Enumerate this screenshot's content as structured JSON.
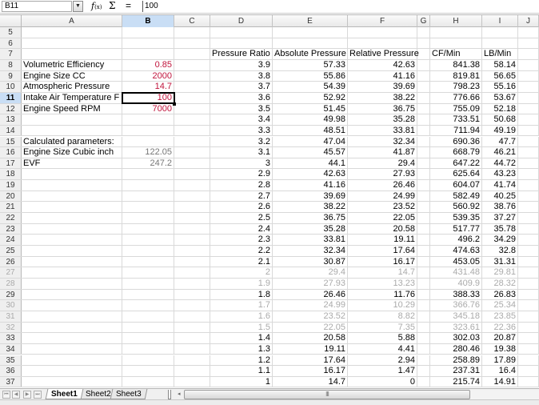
{
  "formula_bar": {
    "cell_ref": "B11",
    "function_wizard_label": "f(x)",
    "sum_label": "Σ",
    "equals_label": "=",
    "formula_value": "100"
  },
  "columns": [
    "A",
    "B",
    "C",
    "D",
    "E",
    "F",
    "G",
    "H",
    "I",
    "J"
  ],
  "selected_column": "B",
  "selected_row": 11,
  "active_cell": "B11",
  "rows": [
    {
      "num": "5",
      "cells": {}
    },
    {
      "num": "6",
      "cells": {}
    },
    {
      "num": "7",
      "cells": {
        "D": "Pressure Ratio",
        "E": "Absolute Pressure",
        "F": "Relative Pressure",
        "H": "CF/Min",
        "I": "LB/Min"
      }
    },
    {
      "num": "8",
      "cells": {
        "A": "Volumetric Efficiency",
        "B": "0.85",
        "D": "3.9",
        "E": "57.33",
        "F": "42.63",
        "H": "841.38",
        "I": "58.14"
      }
    },
    {
      "num": "9",
      "cells": {
        "A": "Engine Size CC",
        "B": "2000",
        "D": "3.8",
        "E": "55.86",
        "F": "41.16",
        "H": "819.81",
        "I": "56.65"
      }
    },
    {
      "num": "10",
      "cells": {
        "A": "Atmospheric Pressure",
        "B": "14.7",
        "D": "3.7",
        "E": "54.39",
        "F": "39.69",
        "H": "798.23",
        "I": "55.16"
      }
    },
    {
      "num": "11",
      "cells": {
        "A": "Intake Air Temperature F",
        "B": "100",
        "D": "3.6",
        "E": "52.92",
        "F": "38.22",
        "H": "776.66",
        "I": "53.67"
      }
    },
    {
      "num": "12",
      "cells": {
        "A": "Engine Speed  RPM",
        "B": "7000",
        "D": "3.5",
        "E": "51.45",
        "F": "36.75",
        "H": "755.09",
        "I": "52.18"
      }
    },
    {
      "num": "13",
      "cells": {
        "D": "3.4",
        "E": "49.98",
        "F": "35.28",
        "H": "733.51",
        "I": "50.68"
      }
    },
    {
      "num": "14",
      "cells": {
        "D": "3.3",
        "E": "48.51",
        "F": "33.81",
        "H": "711.94",
        "I": "49.19"
      }
    },
    {
      "num": "15",
      "cells": {
        "A": "Calculated parameters:",
        "D": "3.2",
        "E": "47.04",
        "F": "32.34",
        "H": "690.36",
        "I": "47.7"
      }
    },
    {
      "num": "16",
      "cells": {
        "A": "Engine Size Cubic inch",
        "B": "122.05",
        "D": "3.1",
        "E": "45.57",
        "F": "41.87",
        "H": "668.79",
        "I": "46.21"
      }
    },
    {
      "num": "17",
      "cells": {
        "A": "EVF",
        "B": "247.2",
        "D": "3",
        "E": "44.1",
        "F": "29.4",
        "H": "647.22",
        "I": "44.72"
      }
    },
    {
      "num": "18",
      "cells": {
        "D": "2.9",
        "E": "42.63",
        "F": "27.93",
        "H": "625.64",
        "I": "43.23"
      }
    },
    {
      "num": "19",
      "cells": {
        "D": "2.8",
        "E": "41.16",
        "F": "26.46",
        "H": "604.07",
        "I": "41.74"
      }
    },
    {
      "num": "20",
      "cells": {
        "D": "2.7",
        "E": "39.69",
        "F": "24.99",
        "H": "582.49",
        "I": "40.25"
      }
    },
    {
      "num": "21",
      "cells": {
        "D": "2.6",
        "E": "38.22",
        "F": "23.52",
        "H": "560.92",
        "I": "38.76"
      }
    },
    {
      "num": "22",
      "cells": {
        "D": "2.5",
        "E": "36.75",
        "F": "22.05",
        "H": "539.35",
        "I": "37.27"
      }
    },
    {
      "num": "23",
      "cells": {
        "D": "2.4",
        "E": "35.28",
        "F": "20.58",
        "H": "517.77",
        "I": "35.78"
      }
    },
    {
      "num": "24",
      "cells": {
        "D": "2.3",
        "E": "33.81",
        "F": "19.11",
        "H": "496.2",
        "I": "34.29"
      }
    },
    {
      "num": "25",
      "cells": {
        "D": "2.2",
        "E": "32.34",
        "F": "17.64",
        "H": "474.63",
        "I": "32.8"
      }
    },
    {
      "num": "26",
      "cells": {
        "D": "2.1",
        "E": "30.87",
        "F": "16.17",
        "H": "453.05",
        "I": "31.31"
      }
    },
    {
      "num": "27",
      "cells": {
        "D": "2",
        "E": "29.4",
        "F": "14.7",
        "H": "431.48",
        "I": "29.81"
      }
    },
    {
      "num": "28",
      "cells": {
        "D": "1.9",
        "E": "27.93",
        "F": "13.23",
        "H": "409.9",
        "I": "28.32"
      }
    },
    {
      "num": "29",
      "cells": {
        "D": "1.8",
        "E": "26.46",
        "F": "11.76",
        "H": "388.33",
        "I": "26.83"
      }
    },
    {
      "num": "30",
      "cells": {
        "D": "1.7",
        "E": "24.99",
        "F": "10.29",
        "H": "366.76",
        "I": "25.34"
      }
    },
    {
      "num": "31",
      "cells": {
        "D": "1.6",
        "E": "23.52",
        "F": "8.82",
        "H": "345.18",
        "I": "23.85"
      }
    },
    {
      "num": "32",
      "cells": {
        "D": "1.5",
        "E": "22.05",
        "F": "7.35",
        "H": "323.61",
        "I": "22.36"
      }
    },
    {
      "num": "33",
      "cells": {
        "D": "1.4",
        "E": "20.58",
        "F": "5.88",
        "H": "302.03",
        "I": "20.87"
      }
    },
    {
      "num": "34",
      "cells": {
        "D": "1.3",
        "E": "19.11",
        "F": "4.41",
        "H": "280.46",
        "I": "19.38"
      }
    },
    {
      "num": "35",
      "cells": {
        "D": "1.2",
        "E": "17.64",
        "F": "2.94",
        "H": "258.89",
        "I": "17.89"
      }
    },
    {
      "num": "36",
      "cells": {
        "D": "1.1",
        "E": "16.17",
        "F": "1.47",
        "H": "237.31",
        "I": "16.4"
      }
    },
    {
      "num": "37",
      "cells": {
        "D": "1",
        "E": "14.7",
        "F": "0",
        "H": "215.74",
        "I": "14.91"
      }
    }
  ],
  "input_color": "#c0143c",
  "sheet_tabs": [
    {
      "label": "Sheet1",
      "active": true
    },
    {
      "label": "Sheet2",
      "active": false
    },
    {
      "label": "Sheet3",
      "active": false
    }
  ],
  "icons": {
    "first_sheet": "⏮",
    "prev_sheet": "◀",
    "next_sheet": "▶",
    "last_sheet": "⏭",
    "name_box_dropdown": "▼",
    "scroll_left": "◂",
    "scroll_grip": "III"
  }
}
